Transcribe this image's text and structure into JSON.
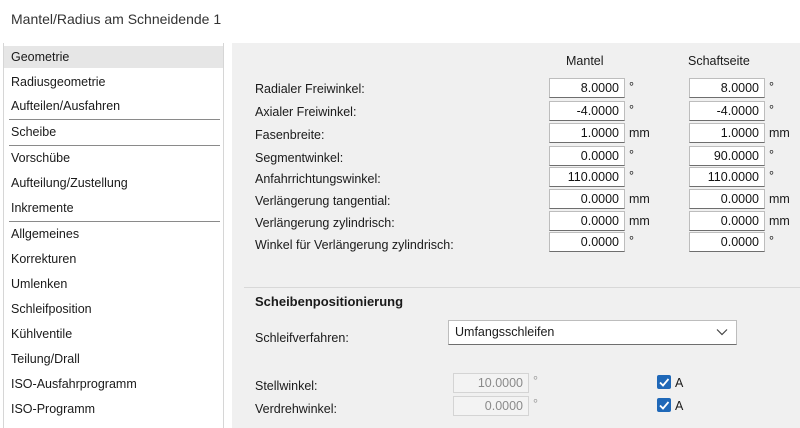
{
  "window": {
    "title": "Mantel/Radius am Schneidende 1"
  },
  "sidebar": {
    "items": [
      {
        "label": "Geometrie"
      },
      {
        "label": "Radiusgeometrie"
      },
      {
        "label": "Aufteilen/Ausfahren"
      },
      {
        "label": "Scheibe"
      },
      {
        "label": "Vorschübe"
      },
      {
        "label": "Aufteilung/Zustellung"
      },
      {
        "label": "Inkremente"
      },
      {
        "label": "Allgemeines"
      },
      {
        "label": "Korrekturen"
      },
      {
        "label": "Umlenken"
      },
      {
        "label": "Schleifposition"
      },
      {
        "label": "Kühlventile"
      },
      {
        "label": "Teilung/Drall"
      },
      {
        "label": "ISO-Ausfahrprogramm"
      },
      {
        "label": "ISO-Programm"
      }
    ],
    "selected": "Geometrie"
  },
  "geometry": {
    "columns": {
      "mantel": "Mantel",
      "schaft": "Schaftseite"
    },
    "rows": [
      {
        "label": "Radialer Freiwinkel:",
        "mantel": "8.0000",
        "schaft": "8.0000",
        "unit": "°"
      },
      {
        "label": "Axialer Freiwinkel:",
        "mantel": "-4.0000",
        "schaft": "-4.0000",
        "unit": "°"
      },
      {
        "label": "Fasenbreite:",
        "mantel": "1.0000",
        "schaft": "1.0000",
        "unit": "mm"
      },
      {
        "label": "Segmentwinkel:",
        "mantel": "0.0000",
        "schaft": "90.0000",
        "unit": "°"
      },
      {
        "label": "Anfahrrichtungswinkel:",
        "mantel": "110.0000",
        "schaft": "110.0000",
        "unit": "°"
      },
      {
        "label": "Verlängerung tangential:",
        "mantel": "0.0000",
        "schaft": "0.0000",
        "unit": "mm"
      },
      {
        "label": "Verlängerung zylindrisch:",
        "mantel": "0.0000",
        "schaft": "0.0000",
        "unit": "mm"
      },
      {
        "label": "Winkel für Verlängerung zylindrisch:",
        "mantel": "0.0000",
        "schaft": "0.0000",
        "unit": "°"
      }
    ]
  },
  "positioning": {
    "title": "Scheibenpositionierung",
    "method_label": "Schleifverfahren:",
    "method_value": "Umfangsschleifen",
    "stellwinkel": {
      "label": "Stellwinkel:",
      "value": "10.0000",
      "unit": "°",
      "auto_label": "A",
      "auto_checked": true
    },
    "verdrehwinkel": {
      "label": "Verdrehwinkel:",
      "value": "0.0000",
      "unit": "°",
      "auto_label": "A",
      "auto_checked": true
    }
  },
  "colors": {
    "accent": "#1f68b8",
    "panel_bg": "#f0f0f0",
    "selected_bg": "#e6e6e6"
  },
  "icons": {
    "dropdown": "chevron-down-icon",
    "check": "checkmark-icon"
  }
}
